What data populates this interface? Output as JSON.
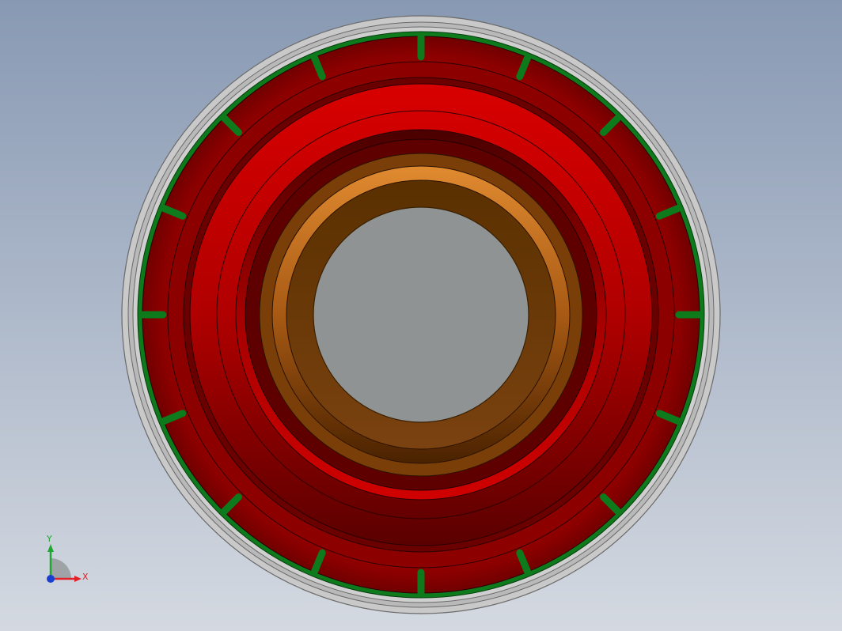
{
  "viewport": {
    "background_top": "#8899b3",
    "background_bottom": "#d4d9e1"
  },
  "model": {
    "outer_ring_color": "#c9c9c9",
    "green_band_color": "#0d7a1c",
    "red_body_color": "#c40000",
    "dark_red_color": "#5a0000",
    "bronze_ring_color": "#c87020",
    "bore_color": "#8f9394",
    "tick_count": 16
  },
  "triad": {
    "x_label": "X",
    "y_label": "Y",
    "x_color": "#e0212a",
    "y_color": "#1ea832",
    "z_color": "#1a3fd0"
  }
}
